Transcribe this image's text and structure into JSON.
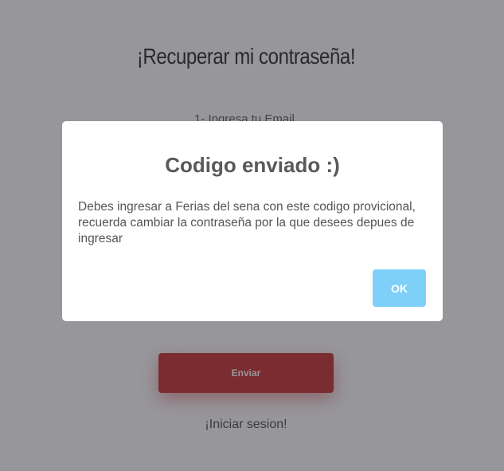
{
  "page": {
    "title": "¡Recuperar mi contraseña!",
    "step_label": "1- Ingresa tu Email",
    "send_button_label": "Enviar",
    "login_link": "¡Iniciar sesion!"
  },
  "modal": {
    "title": "Codigo enviado :)",
    "message": "Debes ingresar a Ferias del sena con este codigo provicional, recuerda cambiar la contraseña por la que desees depues de ingresar",
    "ok_button_label": "OK"
  },
  "colors": {
    "send_button": "#c82a2a",
    "ok_button": "#7fd0f8",
    "overlay": "rgba(45,45,55,0.5)"
  }
}
